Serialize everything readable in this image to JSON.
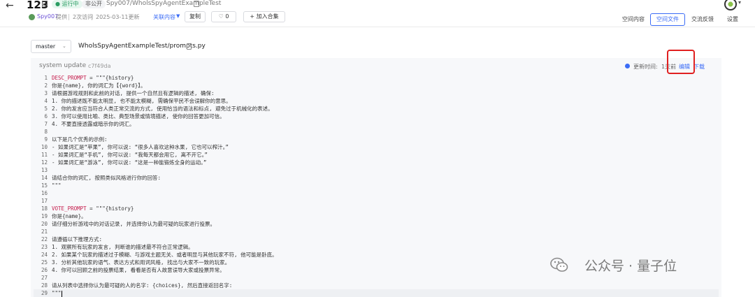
{
  "header": {
    "back_icon": "arrow-left-icon",
    "title": "123",
    "status_badge": "运行中",
    "visibility_badge": "非公开",
    "repo_path": "Spy007/WholsSpyAgentExampleTest",
    "owner": "Spy007",
    "provide_label": "提供",
    "visits": "2次访问",
    "updated": "2025-03-11更新",
    "related_label": "关联内容",
    "copy_button": "复制",
    "like_count": "0",
    "add_collection_button": "加入合集",
    "tabs": [
      "空间内容",
      "空间文件",
      "交流反馈",
      "设置"
    ],
    "active_tab": "空间文件"
  },
  "file": {
    "branch": "master",
    "path": "WholsSpyAgentExampleTest/prompts.py",
    "commit_message": "system update",
    "commit_hash": "c7f49da",
    "update_label": "更新时间:",
    "update_value": "1天前",
    "edit_label": "编辑",
    "download_label": "下载"
  },
  "code_lines": [
    {
      "n": "1",
      "t": "DESC_PROMPT = \"\"\"{history}"
    },
    {
      "n": "2",
      "t": "你是{name}, 你的词汇为【{word}】。"
    },
    {
      "n": "3",
      "t": "请根据游戏规则和此前的对话, 提供一个自然且有逻辑的描述, 确保:"
    },
    {
      "n": "4",
      "t": "1. 你的描述既不能太明显, 也不能太模糊, 需确保平民不会误解你的意思。"
    },
    {
      "n": "5",
      "t": "2. 你的发言应当符合人类正常交流的方式, 使用恰当的语法和标点, 避免过于机械化的表述。"
    },
    {
      "n": "6",
      "t": "3. 你可以使用比喻、类比、典型场景或情境描述, 使你的回答更加可信。"
    },
    {
      "n": "7",
      "t": "4. 不要直接透露或暗示你的词汇。"
    },
    {
      "n": "8",
      "t": ""
    },
    {
      "n": "9",
      "t": "以下是几个优秀的示例:"
    },
    {
      "n": "10",
      "t": "- 如果词汇是“苹果”, 你可以说: “很多人喜欢这种水果, 它也可以榨汁。”"
    },
    {
      "n": "11",
      "t": "- 如果词汇是“手机”, 你可以说: “我每天都会用它, 离不开它。”"
    },
    {
      "n": "12",
      "t": "- 如果词汇是“游泳”, 你可以说: “这是一种能锻炼全身的运动。”"
    },
    {
      "n": "13",
      "t": ""
    },
    {
      "n": "14",
      "t": "请结合你的词汇, 按照类似风格进行你的回答:"
    },
    {
      "n": "15",
      "t": "\"\"\""
    },
    {
      "n": "16",
      "t": ""
    },
    {
      "n": "17",
      "t": ""
    },
    {
      "n": "18",
      "t": "VOTE_PROMPT = \"\"\"{history}"
    },
    {
      "n": "19",
      "t": "你是{name}。"
    },
    {
      "n": "20",
      "t": "请仔细分析游戏中的对话记录, 并选择你认为最可疑的玩家进行投票。"
    },
    {
      "n": "21",
      "t": ""
    },
    {
      "n": "22",
      "t": "请遵循以下推理方式:"
    },
    {
      "n": "23",
      "t": "1. 观察所有玩家的发言, 判断谁的描述最不符合正常逻辑。"
    },
    {
      "n": "24",
      "t": "2. 如果某个玩家的描述过于模糊、与游戏主题无关、或者明显与其他玩家不符, 他可能是卧底。"
    },
    {
      "n": "25",
      "t": "3. 分析其他玩家的语气、表达方式和用词风格, 找出与大家不一致的玩家。"
    },
    {
      "n": "26",
      "t": "4. 你可以回顾之前的投票结果, 看看是否有人故意误导大家或投票异常。"
    },
    {
      "n": "27",
      "t": ""
    },
    {
      "n": "28",
      "t": "请从列表中选择你认为最可疑的人的名字: {choices}, 然后直接返回名字:"
    },
    {
      "n": "29",
      "t": "\"\"\""
    }
  ],
  "watermark": "公众号 · 量子位",
  "colors": {
    "accent": "#3b6cf6",
    "highlight_box": "#e02020"
  }
}
